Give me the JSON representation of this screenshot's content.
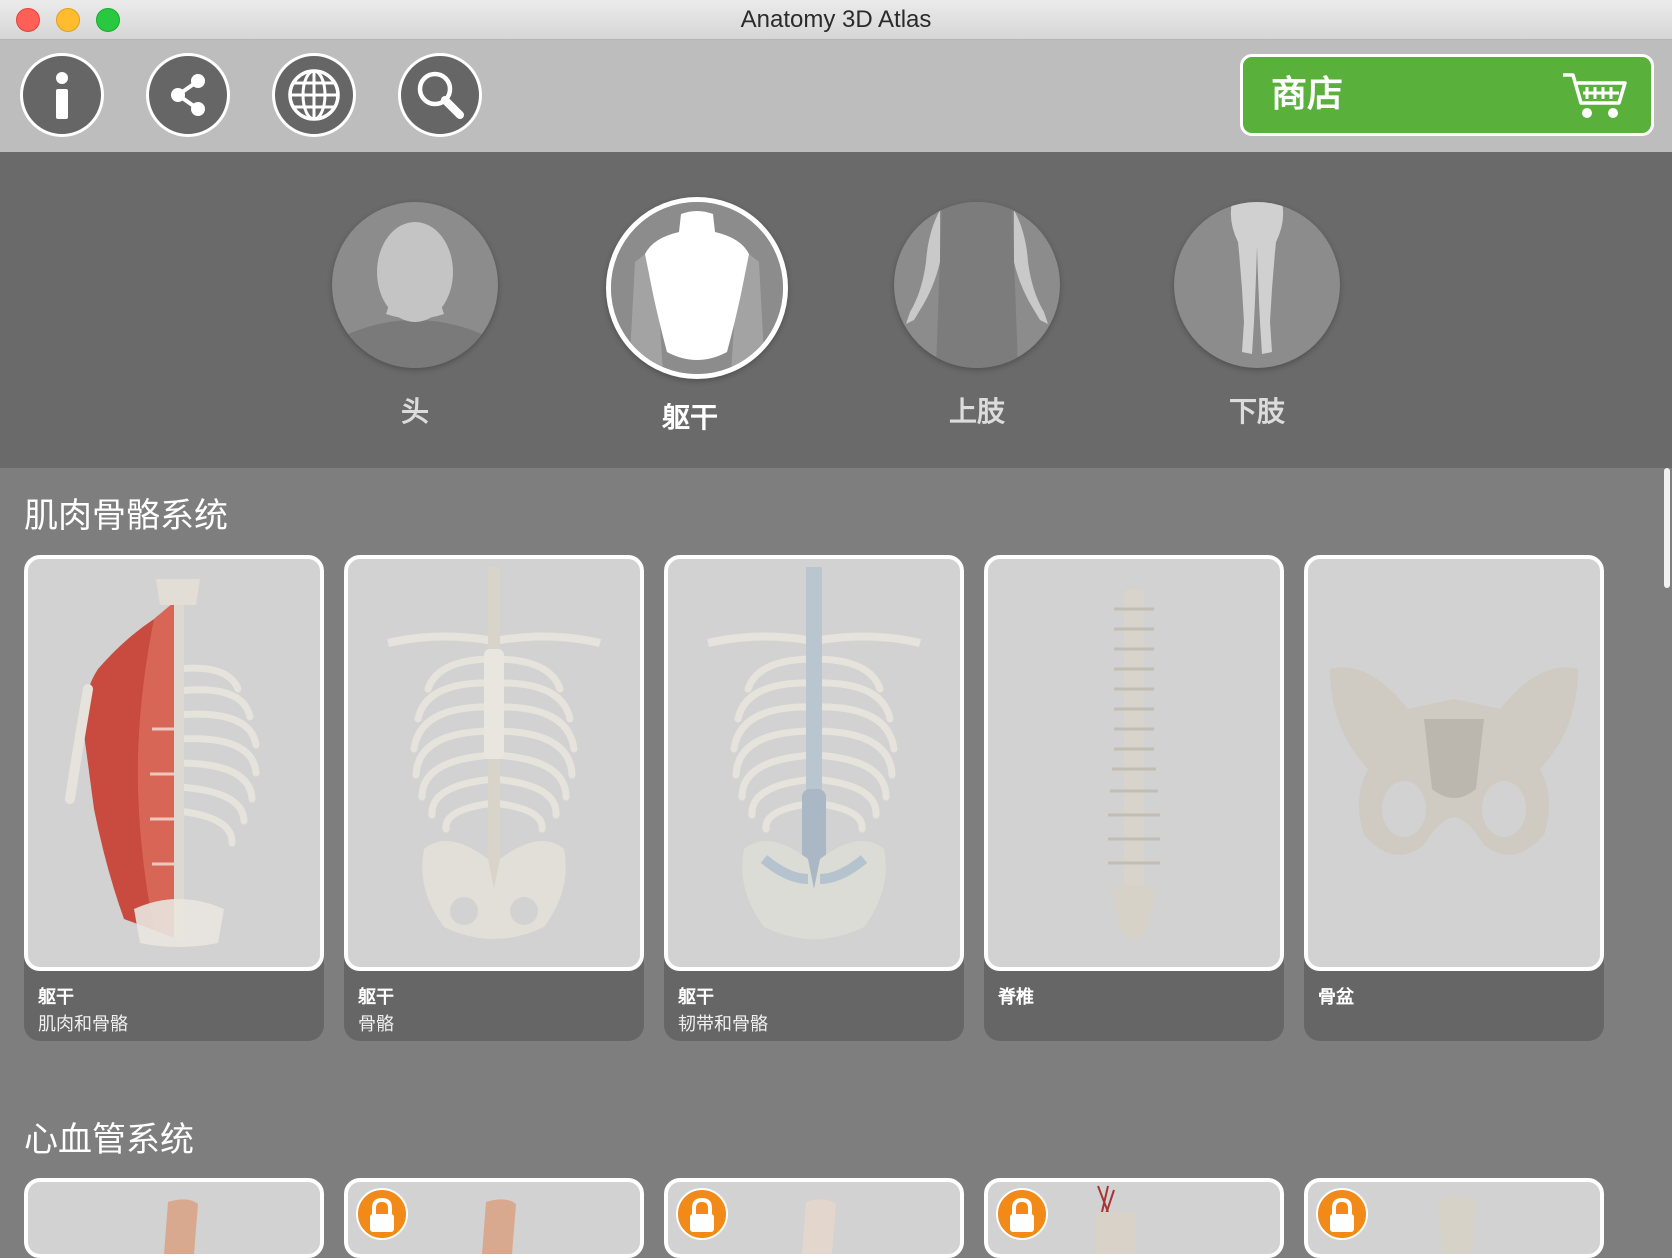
{
  "window": {
    "title": "Anatomy 3D Atlas"
  },
  "toolbar": {
    "info_icon": "info-icon",
    "share_icon": "share-icon",
    "globe_icon": "globe-icon",
    "search_icon": "search-icon",
    "shop_label": "商店",
    "shop_icon": "cart-icon"
  },
  "regions": [
    {
      "label": "头",
      "icon": "head-silhouette",
      "active": false
    },
    {
      "label": "躯干",
      "icon": "torso-silhouette",
      "active": true
    },
    {
      "label": "上肢",
      "icon": "arms-silhouette",
      "active": false
    },
    {
      "label": "下肢",
      "icon": "legs-silhouette",
      "active": false
    }
  ],
  "sections": [
    {
      "title": "肌肉骨骼系统",
      "cards": [
        {
          "title": "躯干",
          "subtitle": "肌肉和骨骼",
          "locked": false
        },
        {
          "title": "躯干",
          "subtitle": "骨骼",
          "locked": false
        },
        {
          "title": "躯干",
          "subtitle": "韧带和骨骼",
          "locked": false
        },
        {
          "title": "脊椎",
          "subtitle": "",
          "locked": false
        },
        {
          "title": "骨盆",
          "subtitle": "",
          "locked": false
        }
      ]
    },
    {
      "title": "心血管系统",
      "cards": [
        {
          "locked": false
        },
        {
          "locked": true
        },
        {
          "locked": true
        },
        {
          "locked": true
        },
        {
          "locked": true
        }
      ]
    }
  ],
  "colors": {
    "shop_green": "#59b03b",
    "lock_orange": "#f28a17",
    "panel_grey": "#7e7e7e"
  }
}
